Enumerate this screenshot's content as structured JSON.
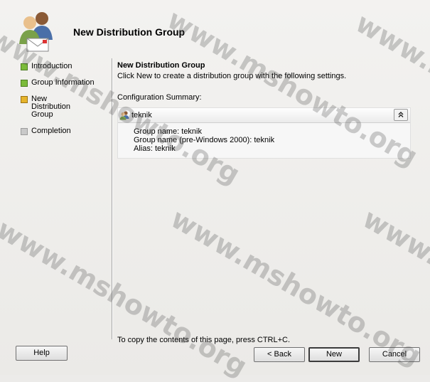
{
  "header": {
    "title": "New Distribution Group"
  },
  "nav": {
    "items": [
      {
        "label": "Introduction",
        "status": "complete"
      },
      {
        "label": "Group Information",
        "status": "complete"
      },
      {
        "label": "New Distribution Group",
        "status": "current"
      },
      {
        "label": "Completion",
        "status": "pending"
      }
    ]
  },
  "content": {
    "title": "New Distribution Group",
    "description": "Click New to create a distribution group with the following settings.",
    "config_label": "Configuration Summary:",
    "summary": {
      "name": "teknik",
      "details": [
        "Group name: teknik",
        "Group name (pre-Windows 2000): teknik",
        "Alias: teknik"
      ]
    },
    "copy_hint": "To copy the contents of this page, press CTRL+C."
  },
  "buttons": {
    "help": "Help",
    "back": "< Back",
    "new": "New",
    "cancel": "Cancel"
  },
  "watermark": {
    "text": "www.mshowto.org"
  },
  "colors": {
    "complete": "#7bbb3a",
    "current": "#e6b42b",
    "pending": "#c9c9c9"
  }
}
